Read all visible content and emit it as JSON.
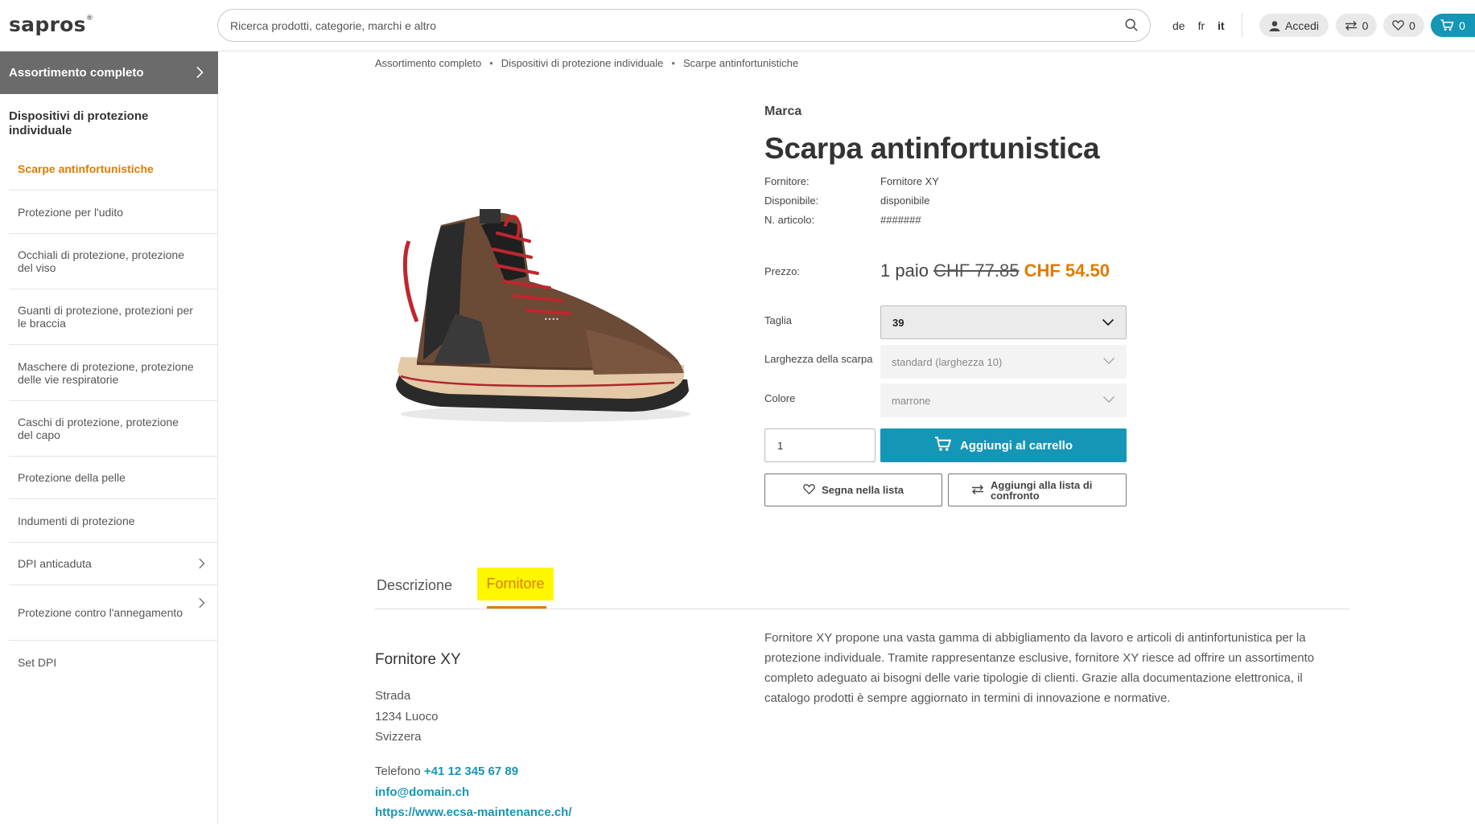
{
  "header": {
    "logo": "sapros",
    "logo_mark": "®",
    "search_placeholder": "Ricerca prodotti, categorie, marchi e altro",
    "languages": [
      "de",
      "fr",
      "it"
    ],
    "active_language": "it",
    "login_label": "Accedi",
    "compare_count": "0",
    "wishlist_count": "0",
    "cart_count": "0"
  },
  "sidebar": {
    "header_label": "Assortimento completo",
    "section_title": "Dispositivi di protezione individuale",
    "items": [
      {
        "label": "Scarpe antinfortunistiche",
        "active": true,
        "has_children": false
      },
      {
        "label": "Protezione per l'udito",
        "active": false,
        "has_children": false
      },
      {
        "label": "Occhiali di protezione, protezione del viso",
        "active": false,
        "has_children": false
      },
      {
        "label": "Guanti di protezione, protezioni per le braccia",
        "active": false,
        "has_children": false
      },
      {
        "label": "Maschere di protezione, protezione delle vie respiratorie",
        "active": false,
        "has_children": false
      },
      {
        "label": "Caschi di protezione, protezione del capo",
        "active": false,
        "has_children": false
      },
      {
        "label": "Protezione della pelle",
        "active": false,
        "has_children": false
      },
      {
        "label": "Indumenti di protezione",
        "active": false,
        "has_children": false
      },
      {
        "label": "DPI anticaduta",
        "active": false,
        "has_children": true
      },
      {
        "label": "Protezione contro l'annegamento",
        "active": false,
        "has_children": true
      },
      {
        "label": "Set DPI",
        "active": false,
        "has_children": false
      }
    ]
  },
  "breadcrumb": [
    "Assortimento completo",
    "Dispositivi di protezione individuale",
    "Scarpe antinfortunistiche"
  ],
  "product": {
    "brand": "Marca",
    "title": "Scarpa antinfortunistica",
    "supplier_label": "Fornitore:",
    "supplier_value": "Fornitore XY",
    "available_label": "Disponibile:",
    "available_value": "disponibile",
    "article_label": "N. articolo:",
    "article_value": "#######",
    "price_label": "Prezzo:",
    "price_unit": "1 paio",
    "price_old": "CHF 77.85",
    "price_new": "CHF 54.50",
    "size_label": "Taglia",
    "size_value": "39",
    "width_label": "Larghezza della scarpa",
    "width_value": "standard (larghezza 10)",
    "color_label": "Colore",
    "color_value": "marrone",
    "quantity": "1",
    "add_to_cart": "Aggiungi al carrello",
    "wishlist_btn": "Segna nella lista",
    "compare_btn": "Aggiungi alla lista di confronto"
  },
  "tabs": {
    "description": "Descrizione",
    "supplier": "Fornitore",
    "active": "supplier"
  },
  "supplier": {
    "name": "Fornitore XY",
    "street": "Strada",
    "city": "1234 Luoco",
    "country": "Svizzera",
    "phone_label": "Telefono",
    "phone": "+41 12 345 67 89",
    "email": "info@domain.ch",
    "website": "https://www.ecsa-maintenance.ch/",
    "description": "Fornitore XY propone una vasta gamma di abbigliamento da lavoro e articoli di antinfortunistica per la protezione individuale. Tramite rappresentanze esclusive, fornitore XY riesce ad offrire un assortimento completo adeguato ai bisogni delle varie tipologie di clienti. Grazie alla documentazione elettronica, il catalogo prodotti è sempre aggiornato in termini di innovazione e normative."
  },
  "colors": {
    "accent_orange": "#e07b00",
    "accent_teal": "#1596b6",
    "tab_highlight": "#fff700",
    "sidebar_header": "#6b6b6b"
  },
  "icons": [
    "search-icon",
    "user-icon",
    "compare-icon",
    "heart-icon",
    "cart-icon",
    "chevron-right-icon",
    "chevron-down-icon"
  ]
}
